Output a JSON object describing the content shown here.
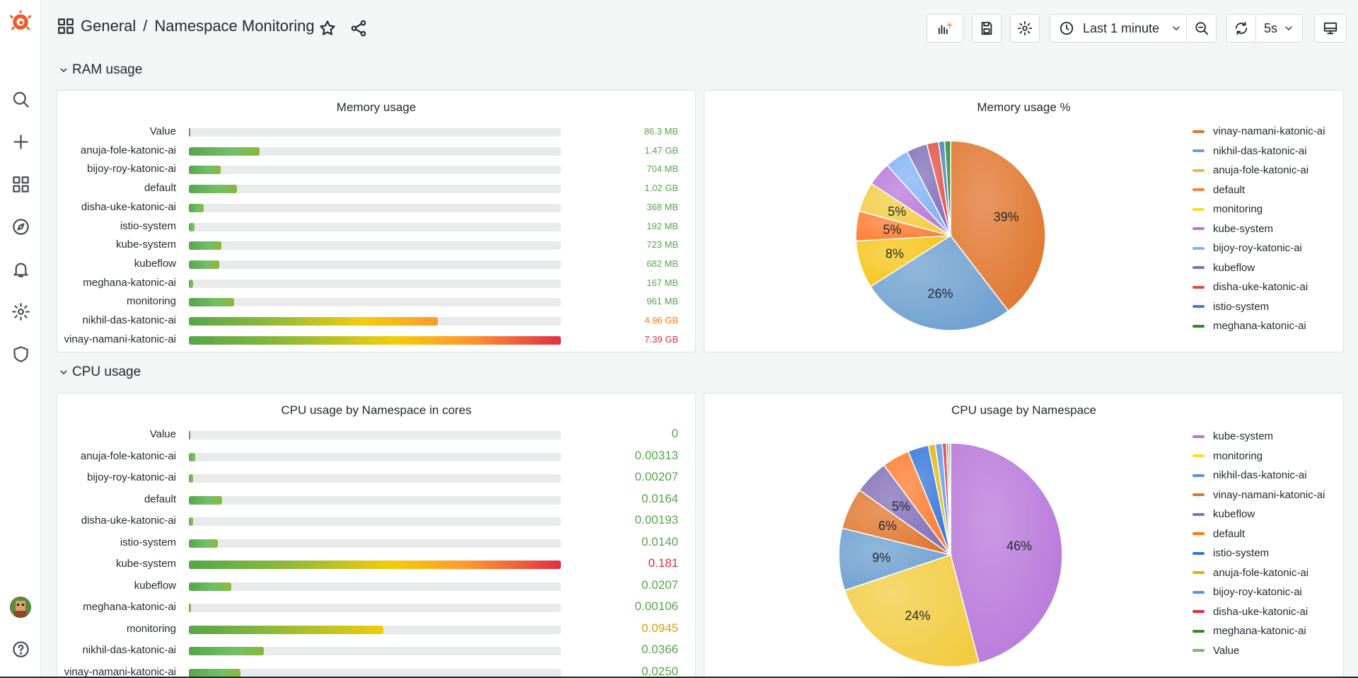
{
  "breadcrumb": {
    "folder": "General",
    "separator": "/",
    "title": "Namespace Monitoring"
  },
  "toolbar": {
    "time_range": "Last 1 minute",
    "refresh_interval": "5s"
  },
  "sidebar": {
    "items": [
      "search-icon",
      "plus-icon",
      "dashboards-icon",
      "explore-icon",
      "alerting-icon",
      "configuration-icon",
      "shield-icon"
    ],
    "help_icon": "help-icon"
  },
  "rows": [
    {
      "title": "RAM usage"
    },
    {
      "title": "CPU usage"
    }
  ],
  "panels": {
    "memory_usage": {
      "title": "Memory usage",
      "rows": [
        {
          "label": "Value",
          "value": "86.3 MB",
          "fraction": 0.0,
          "color": "#56a64b"
        },
        {
          "label": "anuja-fole-katonic-ai",
          "value": "1.47 GB",
          "fraction": 0.19,
          "color": "#56a64b"
        },
        {
          "label": "bijoy-roy-katonic-ai",
          "value": "704 MB",
          "fraction": 0.085,
          "color": "#56a64b"
        },
        {
          "label": "default",
          "value": "1.02 GB",
          "fraction": 0.13,
          "color": "#56a64b"
        },
        {
          "label": "disha-uke-katonic-ai",
          "value": "368 MB",
          "fraction": 0.04,
          "color": "#56a64b"
        },
        {
          "label": "istio-system",
          "value": "192 MB",
          "fraction": 0.015,
          "color": "#56a64b"
        },
        {
          "label": "kube-system",
          "value": "723 MB",
          "fraction": 0.087,
          "color": "#56a64b"
        },
        {
          "label": "kubeflow",
          "value": "682 MB",
          "fraction": 0.082,
          "color": "#56a64b"
        },
        {
          "label": "meghana-katonic-ai",
          "value": "167 MB",
          "fraction": 0.012,
          "color": "#56a64b"
        },
        {
          "label": "monitoring",
          "value": "961 MB",
          "fraction": 0.122,
          "color": "#56a64b"
        },
        {
          "label": "nikhil-das-katonic-ai",
          "value": "4.96 GB",
          "fraction": 0.67,
          "color": "#ff780a"
        },
        {
          "label": "vinay-namani-katonic-ai",
          "value": "7.39 GB",
          "fraction": 1.0,
          "color": "#e02f44"
        }
      ]
    },
    "memory_pct": {
      "title": "Memory usage %",
      "legend": [
        {
          "name": "vinay-namani-katonic-ai",
          "color": "#e0752d"
        },
        {
          "name": "nikhil-das-katonic-ai",
          "color": "#6d9fcf"
        },
        {
          "name": "anuja-fole-katonic-ai",
          "color": "#eab839"
        },
        {
          "name": "default",
          "color": "#ef843c"
        },
        {
          "name": "monitoring",
          "color": "#fade2a"
        },
        {
          "name": "kube-system",
          "color": "#b877d9"
        },
        {
          "name": "bijoy-roy-katonic-ai",
          "color": "#7eb2f7"
        },
        {
          "name": "kubeflow",
          "color": "#806eb7"
        },
        {
          "name": "disha-uke-katonic-ai",
          "color": "#e24d42"
        },
        {
          "name": "istio-system",
          "color": "#447ebc"
        },
        {
          "name": "meghana-katonic-ai",
          "color": "#2f8a2f"
        }
      ]
    },
    "cpu_cores": {
      "title": "CPU usage by Namespace in cores",
      "rows": [
        {
          "label": "Value",
          "value": "0",
          "fraction": 0.0,
          "color": "#56a64b"
        },
        {
          "label": "anuja-fole-katonic-ai",
          "value": "0.00313",
          "fraction": 0.017,
          "color": "#56a64b"
        },
        {
          "label": "bijoy-roy-katonic-ai",
          "value": "0.00207",
          "fraction": 0.011,
          "color": "#56a64b"
        },
        {
          "label": "default",
          "value": "0.0164",
          "fraction": 0.09,
          "color": "#56a64b"
        },
        {
          "label": "disha-uke-katonic-ai",
          "value": "0.00193",
          "fraction": 0.011,
          "color": "#56a64b"
        },
        {
          "label": "istio-system",
          "value": "0.0140",
          "fraction": 0.077,
          "color": "#56a64b"
        },
        {
          "label": "kube-system",
          "value": "0.181",
          "fraction": 1.0,
          "color": "#e02f44"
        },
        {
          "label": "kubeflow",
          "value": "0.0207",
          "fraction": 0.114,
          "color": "#56a64b"
        },
        {
          "label": "meghana-katonic-ai",
          "value": "0.00106",
          "fraction": 0.006,
          "color": "#56a64b"
        },
        {
          "label": "monitoring",
          "value": "0.0945",
          "fraction": 0.522,
          "color": "#e0b400"
        },
        {
          "label": "nikhil-das-katonic-ai",
          "value": "0.0366",
          "fraction": 0.202,
          "color": "#56a64b"
        },
        {
          "label": "vinay-namani-katonic-ai",
          "value": "0.0250",
          "fraction": 0.138,
          "color": "#56a64b"
        }
      ]
    },
    "cpu_pie": {
      "title": "CPU usage by Namespace",
      "legend": [
        {
          "name": "kube-system",
          "color": "#b877d9"
        },
        {
          "name": "monitoring",
          "color": "#fade2a"
        },
        {
          "name": "nikhil-das-katonic-ai",
          "color": "#5794f2"
        },
        {
          "name": "vinay-namani-katonic-ai",
          "color": "#e0752d"
        },
        {
          "name": "kubeflow",
          "color": "#806eb7"
        },
        {
          "name": "default",
          "color": "#ff780a"
        },
        {
          "name": "istio-system",
          "color": "#3274d9"
        },
        {
          "name": "anuja-fole-katonic-ai",
          "color": "#e0b400"
        },
        {
          "name": "bijoy-roy-katonic-ai",
          "color": "#5794f2"
        },
        {
          "name": "disha-uke-katonic-ai",
          "color": "#e02f44"
        },
        {
          "name": "meghana-katonic-ai",
          "color": "#37872d"
        },
        {
          "name": "Value",
          "color": "#73bf69"
        }
      ]
    }
  },
  "chart_data": [
    {
      "type": "pie",
      "title": "Memory usage %",
      "categories": [
        "vinay-namani-katonic-ai",
        "nikhil-das-katonic-ai",
        "anuja-fole-katonic-ai",
        "default",
        "monitoring",
        "kube-system",
        "bijoy-roy-katonic-ai",
        "kubeflow",
        "disha-uke-katonic-ai",
        "istio-system",
        "meghana-katonic-ai"
      ],
      "values": [
        39,
        26,
        8,
        5,
        5,
        4,
        4,
        3.5,
        2,
        1,
        1
      ],
      "labels": [
        "39%",
        "26%",
        "8%",
        "5%",
        "5%",
        "",
        "",
        "",
        "",
        "",
        ""
      ],
      "colors": [
        "#e0752d",
        "#6d9fcf",
        "#f5c518",
        "#ff7b2e",
        "#f2cc40",
        "#b877d9",
        "#7eb2f7",
        "#806eb7",
        "#e24d42",
        "#447ebc",
        "#2f8a2f"
      ]
    },
    {
      "type": "pie",
      "title": "CPU usage by Namespace",
      "categories": [
        "kube-system",
        "monitoring",
        "nikhil-das-katonic-ai",
        "vinay-namani-katonic-ai",
        "kubeflow",
        "default",
        "istio-system",
        "anuja-fole-katonic-ai",
        "bijoy-roy-katonic-ai",
        "disha-uke-katonic-ai",
        "meghana-katonic-ai",
        "Value"
      ],
      "values": [
        46,
        24,
        9,
        6,
        5,
        4,
        3,
        1,
        1,
        0.6,
        0.3,
        0.3
      ],
      "labels": [
        "46%",
        "24%",
        "9%",
        "6%",
        "5%",
        "",
        "",
        "",
        "",
        "",
        "",
        ""
      ],
      "colors": [
        "#b877d9",
        "#f2cc40",
        "#6d9fcf",
        "#e0752d",
        "#806eb7",
        "#ff7b2e",
        "#3274d9",
        "#e0b400",
        "#5794f2",
        "#e02f44",
        "#37872d",
        "#73bf69"
      ]
    }
  ]
}
